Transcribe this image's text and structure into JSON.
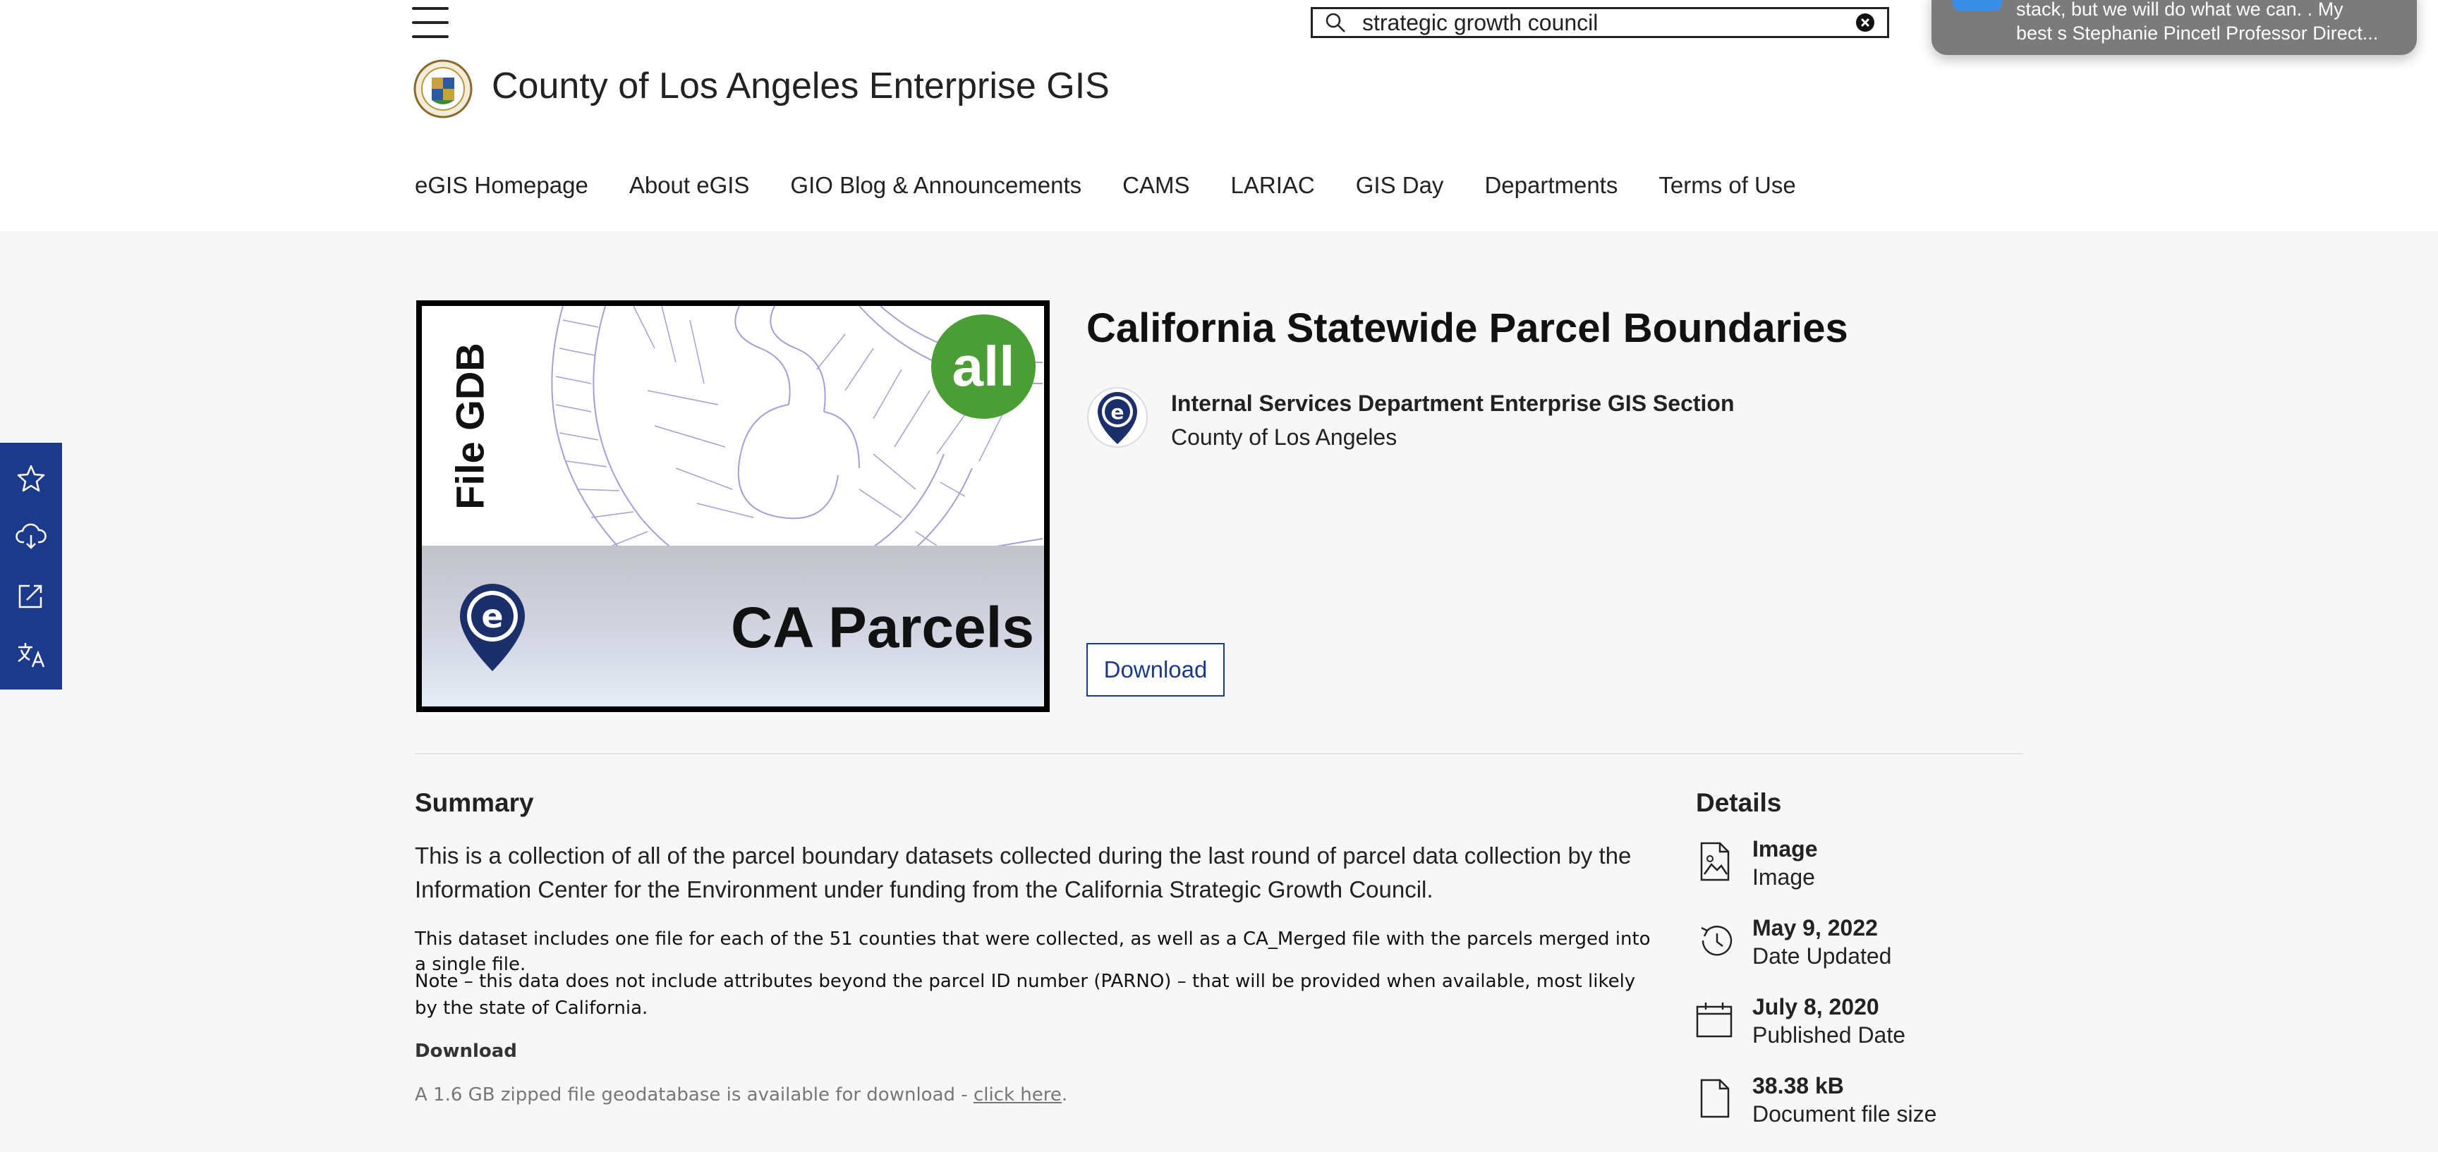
{
  "header": {
    "site_title": "County of Los Angeles Enterprise GIS",
    "search_value": "strategic growth council",
    "nav": [
      "eGIS Homepage",
      "About eGIS",
      "GIO Blog & Announcements",
      "CAMS",
      "LARIAC",
      "GIS Day",
      "Departments",
      "Terms of Use"
    ]
  },
  "notification": {
    "line1": "stack, but we will do what we can. . My",
    "line2": "best s Stephanie Pincetl Professor Direct..."
  },
  "thumbnail": {
    "side_text": "File GDB",
    "badge_text": "all",
    "main_text": "CA Parcels",
    "pin_letter": "e",
    "badge_color": "#4a9e35"
  },
  "item": {
    "title": "California Statewide Parcel Boundaries",
    "owner_name": "Internal Services Department Enterprise GIS Section",
    "owner_org": "County of Los Angeles",
    "owner_logo_letter": "e",
    "download_label": "Download"
  },
  "summary": {
    "heading": "Summary",
    "p1": "This is a collection of all of the parcel boundary datasets collected during the last round of parcel data collection by the Information Center for the Environment under funding from the California Strategic Growth Council.",
    "p2": "This dataset includes one file for each of the 51 counties that were collected, as well as a CA_Merged file with the parcels merged into a single file.",
    "p3": "Note – this data does not include attributes beyond the parcel ID number (PARNO) – that will be provided when available, most likely by the state of California.",
    "download_heading": "Download",
    "p4_prefix": "A 1.6 GB zipped file geodatabase is available for download - ",
    "p4_link": "click here",
    "p4_suffix": "."
  },
  "details": {
    "heading": "Details",
    "rows": [
      {
        "value": "Image",
        "label": "Image",
        "icon": "image-file-icon"
      },
      {
        "value": "May 9, 2022",
        "label": "Date Updated",
        "icon": "history-icon"
      },
      {
        "value": "July 8, 2020",
        "label": "Published Date",
        "icon": "calendar-icon"
      },
      {
        "value": "38.38 kB",
        "label": "Document file size",
        "icon": "document-icon"
      }
    ]
  },
  "sidebar": {
    "buttons": [
      "star-icon",
      "cloud-download-icon",
      "share-icon",
      "translate-icon"
    ]
  },
  "colors": {
    "sidebar": "#1b3a8c",
    "accent": "#1b3a8c",
    "page_background": "#f7f7f7"
  }
}
